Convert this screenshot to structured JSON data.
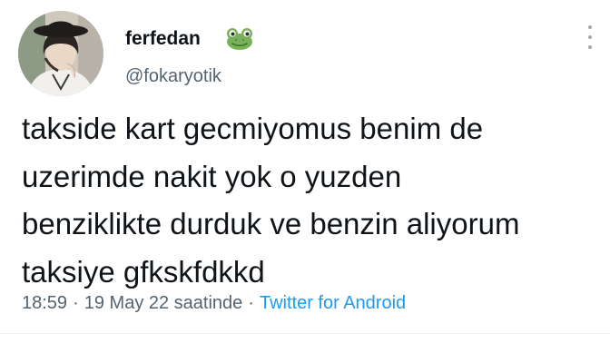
{
  "tweet": {
    "author": {
      "display_name": "ferfedan",
      "badge_icon": "frog-emoji-icon",
      "handle": "@fokaryotik",
      "avatar_icon": "profile-photo-avatar"
    },
    "text_lines": [
      "takside kart gecmiyomus benim de",
      "uzerimde nakit yok o yuzden",
      "benziklikte durduk ve benzin aliyorum",
      "taksiye gfkskfdkkd"
    ],
    "time": "18:59",
    "date": "19 May 22 saatinde",
    "separator": "·",
    "source": "Twitter for Android",
    "more_icon": "vertical-ellipsis-icon"
  },
  "colors": {
    "text": "#0f1419",
    "secondary_text": "#536471",
    "link": "#1d9bf0",
    "frog_green": "#78b159"
  }
}
